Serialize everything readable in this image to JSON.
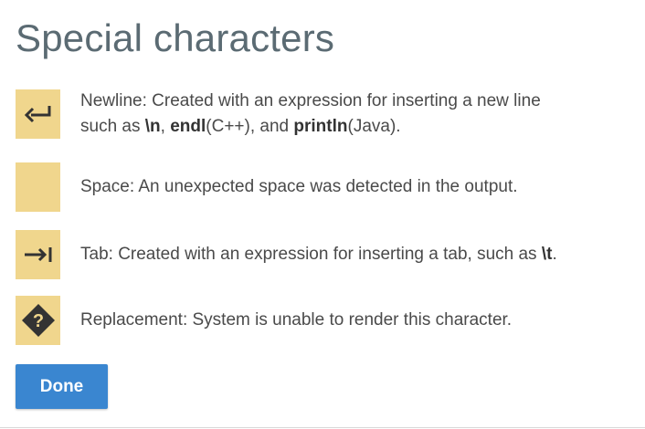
{
  "dialog": {
    "title": "Special characters",
    "items": [
      {
        "icon": "newline-return-icon",
        "text_parts": [
          "Newline: Created with an expression for inserting a new line",
          "such as ",
          "\\n",
          ", ",
          "endl",
          "(C++), and ",
          "println",
          "(Java)."
        ]
      },
      {
        "icon": "space-blank-icon",
        "text": "Space: An unexpected space was detected in the output."
      },
      {
        "icon": "tab-arrow-icon",
        "text_parts": [
          "Tab: Created with an expression for inserting a tab, such as ",
          "\\t",
          "."
        ]
      },
      {
        "icon": "replacement-question-diamond-icon",
        "text": "Replacement: System is unable to render this character."
      }
    ],
    "done_label": "Done"
  },
  "colors": {
    "title": "#5b6b73",
    "swatch": "#f0d68d",
    "icon": "#333333",
    "button": "#3a86d0",
    "button_text": "#ffffff"
  }
}
